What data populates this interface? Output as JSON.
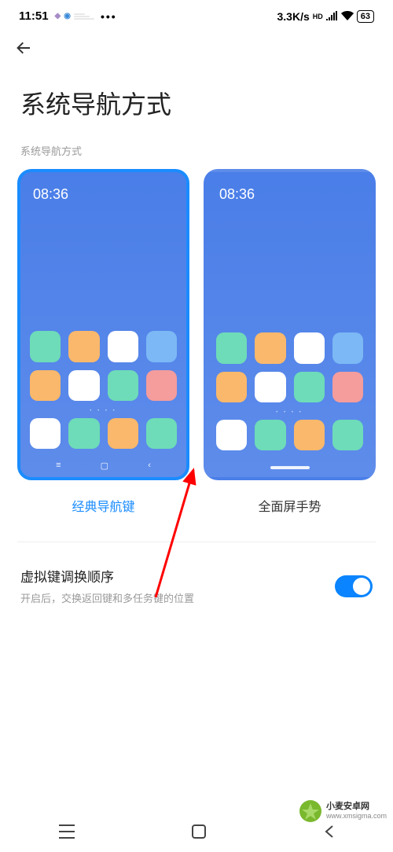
{
  "status_bar": {
    "time": "11:51",
    "dots": "•••",
    "speed": "3.3K/s",
    "hd": "HD",
    "battery": "63"
  },
  "page": {
    "title": "系统导航方式",
    "section_label": "系统导航方式"
  },
  "options": {
    "classic": {
      "label": "经典导航键",
      "preview_time": "08:36",
      "selected": true
    },
    "gesture": {
      "label": "全面屏手势",
      "preview_time": "08:36",
      "selected": false
    }
  },
  "setting": {
    "title": "虚拟键调换顺序",
    "desc": "开启后，交换返回键和多任务键的位置",
    "toggle_on": true
  },
  "watermark": {
    "name": "小麦安卓网",
    "url": "www.xmsigma.com"
  },
  "colors": {
    "accent": "#1a8cff",
    "toggle": "#0a84ff",
    "arrow": "#ff0000"
  }
}
